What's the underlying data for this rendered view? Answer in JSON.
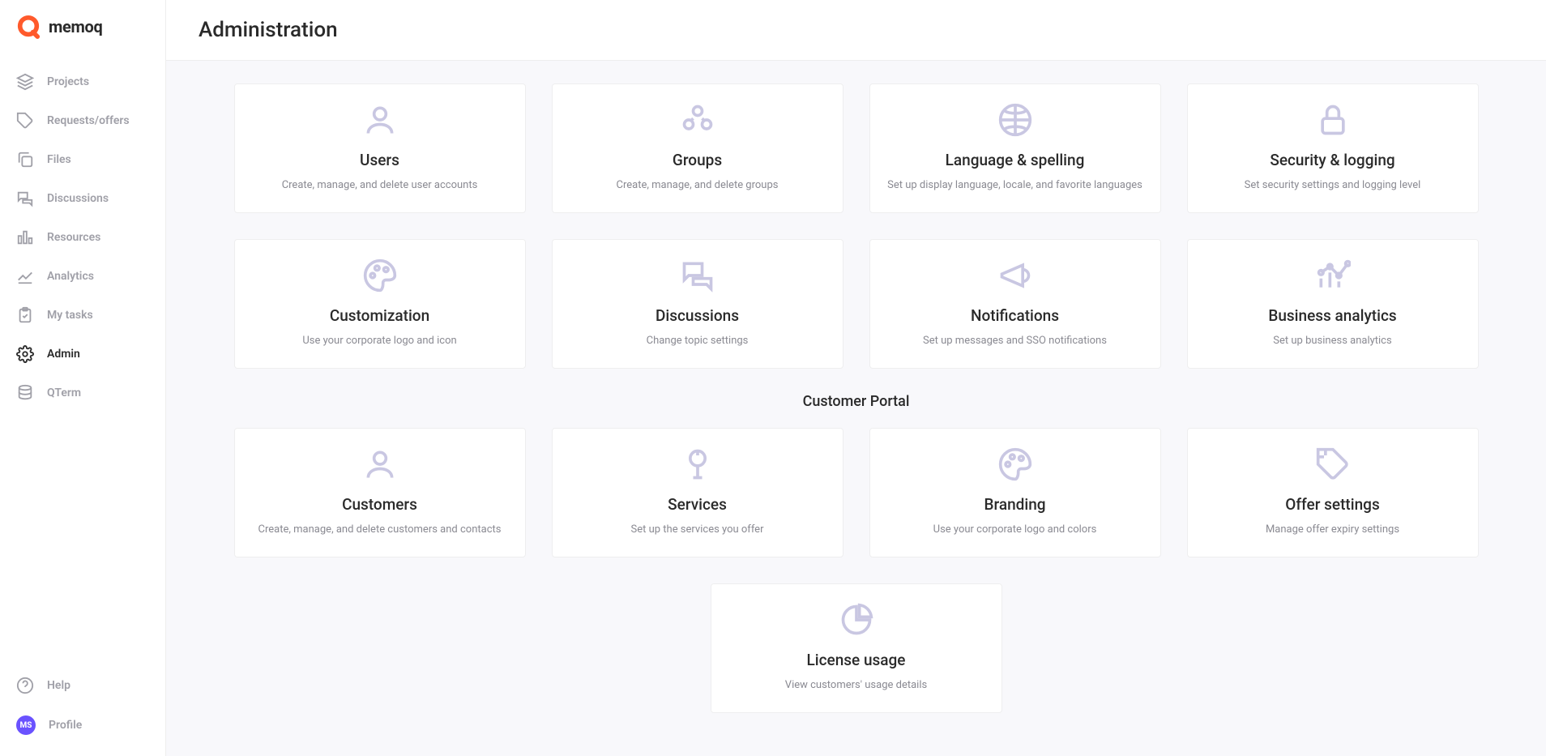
{
  "brand": {
    "name": "memoq"
  },
  "header": {
    "title": "Administration"
  },
  "sidebar": {
    "items": [
      {
        "label": "Projects"
      },
      {
        "label": "Requests/offers"
      },
      {
        "label": "Files"
      },
      {
        "label": "Discussions"
      },
      {
        "label": "Resources"
      },
      {
        "label": "Analytics"
      },
      {
        "label": "My tasks"
      },
      {
        "label": "Admin"
      },
      {
        "label": "QTerm"
      }
    ],
    "footer": [
      {
        "label": "Help"
      },
      {
        "label": "Profile",
        "initials": "MS"
      }
    ]
  },
  "sections": {
    "main_tiles": [
      {
        "title": "Users",
        "desc": "Create, manage, and delete user accounts"
      },
      {
        "title": "Groups",
        "desc": "Create, manage, and delete groups"
      },
      {
        "title": "Language & spelling",
        "desc": "Set up display language, locale, and favorite languages"
      },
      {
        "title": "Security & logging",
        "desc": "Set security settings and logging level"
      },
      {
        "title": "Customization",
        "desc": "Use your corporate logo and icon"
      },
      {
        "title": "Discussions",
        "desc": "Change topic settings"
      },
      {
        "title": "Notifications",
        "desc": "Set up messages and SSO notifications"
      },
      {
        "title": "Business analytics",
        "desc": "Set up business analytics"
      }
    ],
    "customer_portal_heading": "Customer Portal",
    "portal_tiles": [
      {
        "title": "Customers",
        "desc": "Create, manage, and delete customers and contacts"
      },
      {
        "title": "Services",
        "desc": "Set up the services you offer"
      },
      {
        "title": "Branding",
        "desc": "Use your corporate logo and colors"
      },
      {
        "title": "Offer settings",
        "desc": "Manage offer expiry settings"
      }
    ],
    "license_tile": {
      "title": "License usage",
      "desc": "View customers' usage details"
    }
  }
}
